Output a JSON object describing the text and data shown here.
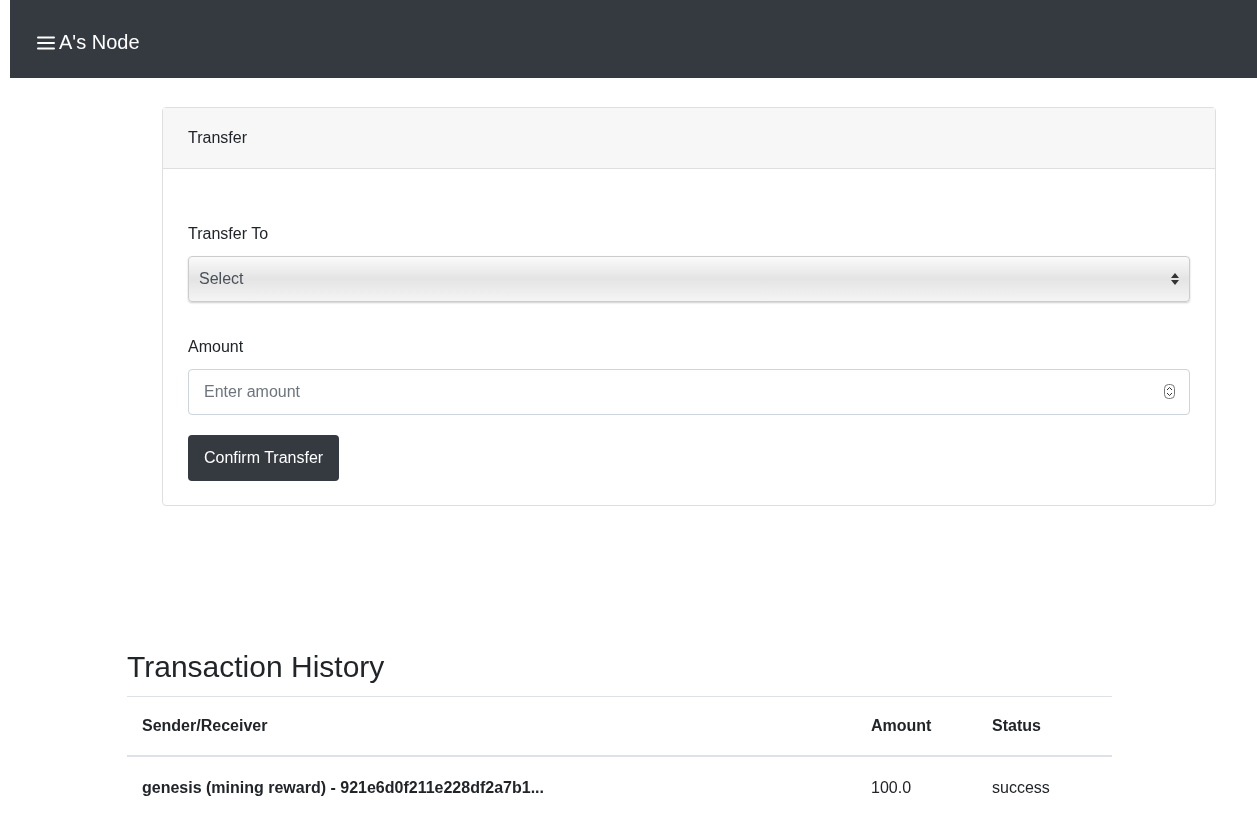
{
  "navbar": {
    "title": "A's Node"
  },
  "transfer_card": {
    "title": "Transfer",
    "transfer_to": {
      "label": "Transfer To",
      "value": "Select"
    },
    "amount": {
      "label": "Amount",
      "placeholder": "Enter amount"
    },
    "button": "Confirm Transfer"
  },
  "transaction_history": {
    "title": "Transaction History",
    "columns": [
      "Sender/Receiver",
      "Amount",
      "Status"
    ],
    "rows": [
      {
        "party": "genesis (mining reward) - 921e6d0f211e228df2a7b1...",
        "amount": "100.0",
        "status": "success"
      }
    ]
  }
}
